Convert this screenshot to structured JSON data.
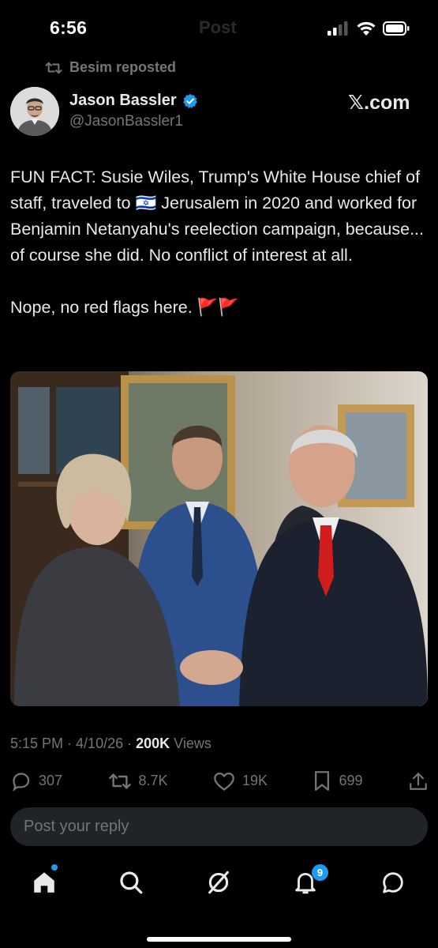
{
  "status_bar": {
    "time": "6:56",
    "ghost_title": "Post"
  },
  "repost": {
    "label": "Besim reposted"
  },
  "author": {
    "name": "Jason Bassler",
    "handle": "@JasonBassler1",
    "verified": true
  },
  "site_label": "𝕏.com",
  "post": {
    "paragraph1": "FUN FACT: Susie Wiles, Trump's White House chief of staff, traveled to 🇮🇱 Jerusalem in 2020 and worked for Benjamin Netanyahu's reelection campaign, because... of course she did. No conflict of interest at all.",
    "paragraph2": "Nope, no red flags here. 🚩🚩"
  },
  "meta": {
    "time": "5:15 PM",
    "sep1": "·",
    "date": "4/10/26",
    "sep2": "·",
    "views_count": "200K",
    "views_label": "Views"
  },
  "actions": {
    "replies": "307",
    "reposts": "8.7K",
    "likes": "19K",
    "bookmarks": "699"
  },
  "reply": {
    "placeholder": "Post your reply"
  },
  "nav": {
    "notifications_badge": "9"
  },
  "colors": {
    "accent": "#1d9bf0",
    "background": "#000000",
    "muted": "#71767b"
  }
}
